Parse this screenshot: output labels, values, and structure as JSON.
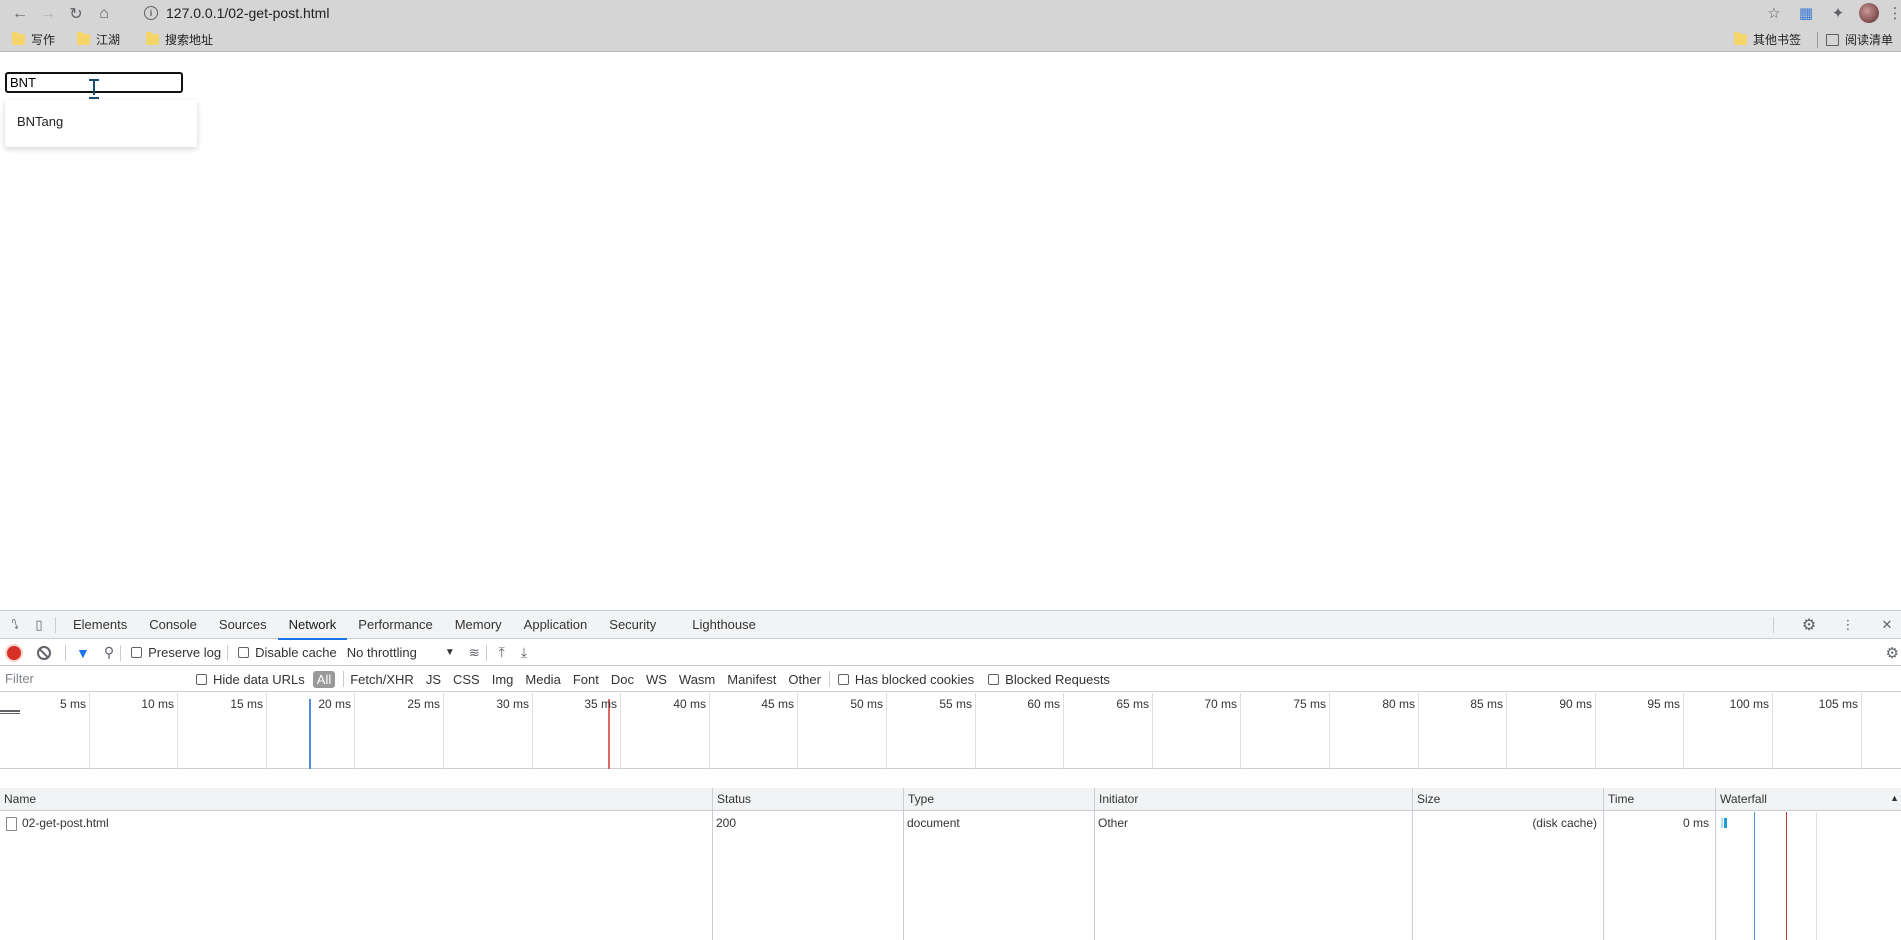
{
  "browser": {
    "url": "127.0.0.1/02-get-post.html",
    "bookmarks": [
      "写作",
      "江湖",
      "搜索地址"
    ],
    "bookmarks_right": [
      "其他书签",
      "阅读清单"
    ]
  },
  "page": {
    "search_value": "BNT",
    "suggestions": [
      "BNTang"
    ]
  },
  "devtools": {
    "tabs": [
      "Elements",
      "Console",
      "Sources",
      "Network",
      "Performance",
      "Memory",
      "Application",
      "Security",
      "Lighthouse"
    ],
    "active_tab": "Network",
    "toolbar": {
      "preserve_log": "Preserve log",
      "disable_cache": "Disable cache",
      "throttling": "No throttling"
    },
    "filter": {
      "placeholder": "Filter",
      "hide_data_urls": "Hide data URLs",
      "types": [
        "All",
        "Fetch/XHR",
        "JS",
        "CSS",
        "Img",
        "Media",
        "Font",
        "Doc",
        "WS",
        "Wasm",
        "Manifest",
        "Other"
      ],
      "has_blocked_cookies": "Has blocked cookies",
      "blocked_requests": "Blocked Requests"
    },
    "timeline_ticks": [
      "5 ms",
      "10 ms",
      "15 ms",
      "20 ms",
      "25 ms",
      "30 ms",
      "35 ms",
      "40 ms",
      "45 ms",
      "50 ms",
      "55 ms",
      "60 ms",
      "65 ms",
      "70 ms",
      "75 ms",
      "80 ms",
      "85 ms",
      "90 ms",
      "95 ms",
      "100 ms",
      "105 ms"
    ],
    "columns": [
      "Name",
      "Status",
      "Type",
      "Initiator",
      "Size",
      "Time",
      "Waterfall"
    ],
    "rows": [
      {
        "name": "02-get-post.html",
        "status": "200",
        "type": "document",
        "initiator": "Other",
        "size": "(disk cache)",
        "time": "0 ms"
      }
    ]
  }
}
